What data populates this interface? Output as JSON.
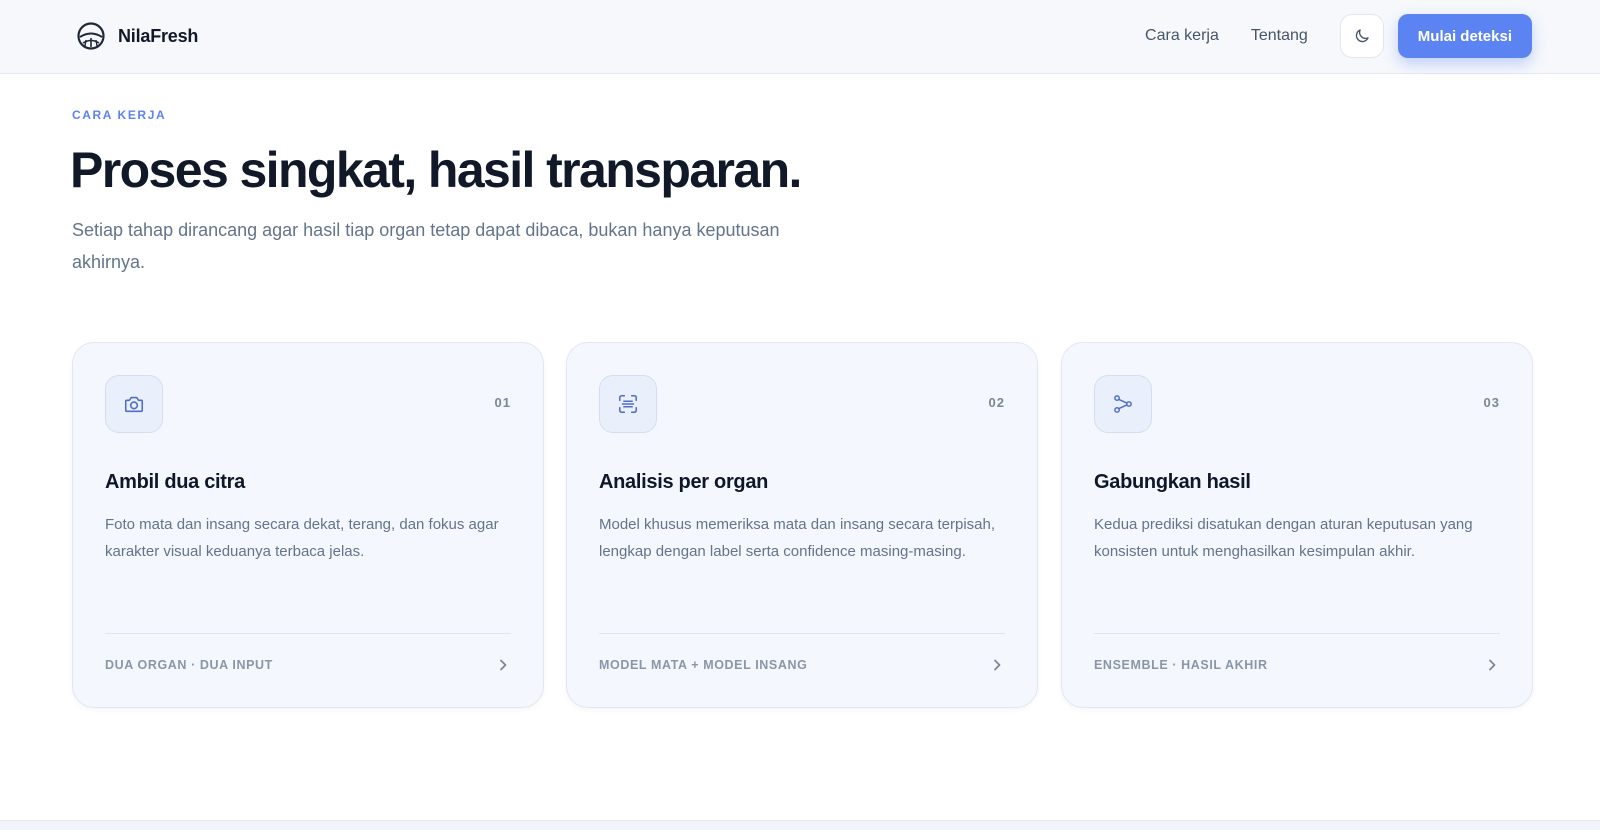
{
  "brand": {
    "name": "NilaFresh",
    "logo_icon": "fish-eye-logo-icon"
  },
  "nav": {
    "links": [
      "Cara kerja",
      "Tentang"
    ],
    "theme_toggle_icon": "moon-icon",
    "cta_label": "Mulai deteksi"
  },
  "section": {
    "eyebrow": "CARA KERJA",
    "title": "Proses singkat, hasil transparan.",
    "subtitle": "Setiap tahap dirancang agar hasil tiap organ tetap dapat dibaca, bukan hanya keputusan akhirnya."
  },
  "cards": [
    {
      "icon": "camera-icon",
      "number": "01",
      "title": "Ambil dua citra",
      "description": "Foto mata dan insang secara dekat, terang, dan fokus agar karakter visual keduanya terbaca jelas.",
      "tag": "DUA ORGAN · DUA INPUT"
    },
    {
      "icon": "scan-icon",
      "number": "02",
      "title": "Analisis per organ",
      "description": "Model khusus memeriksa mata dan insang secara terpisah, lengkap dengan label serta confidence masing-masing.",
      "tag": "MODEL MATA + MODEL INSANG"
    },
    {
      "icon": "merge-icon",
      "number": "03",
      "title": "Gabungkan hasil",
      "description": "Kedua prediksi disatukan dengan aturan keputusan yang konsisten untuk menghasilkan kesimpulan akhir.",
      "tag": "ENSEMBLE · HASIL AKHIR"
    }
  ],
  "colors": {
    "accent": "#5b84f2",
    "card_bg": "#f4f7fd",
    "heading": "#111827",
    "muted": "#64748b"
  }
}
